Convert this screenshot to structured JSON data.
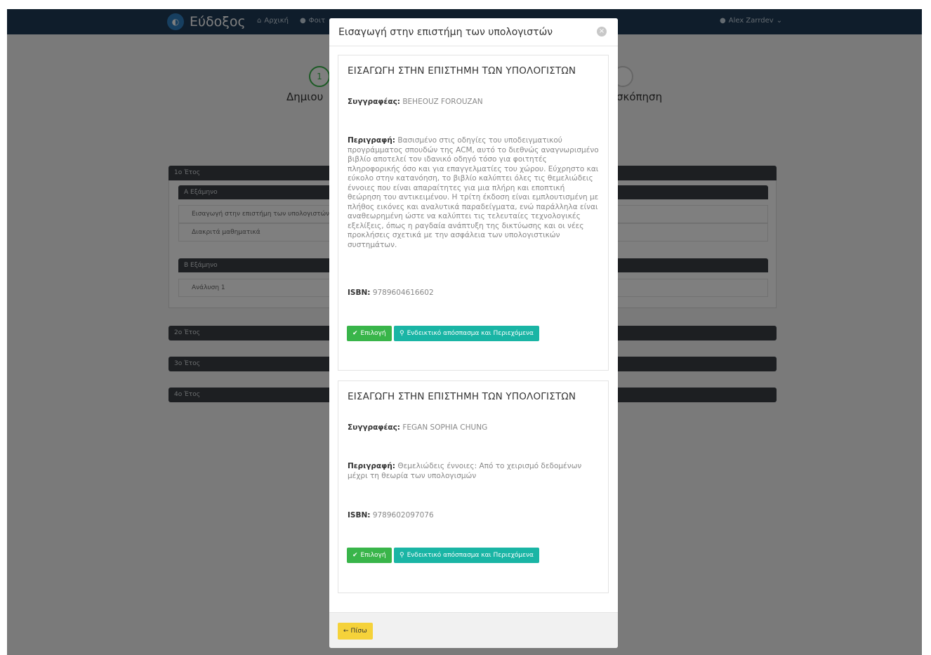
{
  "navbar": {
    "brand": "Εύδοξος",
    "links": [
      {
        "label": "Αρχική",
        "icon": "home-icon"
      },
      {
        "label": "Φοιτ",
        "icon": "user-icon"
      }
    ],
    "user": {
      "name": "Alex Zarrdev",
      "icon": "user-icon"
    }
  },
  "wizard": {
    "step1_number": "1",
    "step1_label": "Δημιου",
    "step_last_label": "σκόπηση"
  },
  "background": {
    "year1": "1ο Έτος",
    "semester_a": "Α Εξάμηνο",
    "semester_a_courses": [
      "Εισαγωγή στην επιστήμη των υπολογιστών",
      "Διακριτά μαθηματικά"
    ],
    "semester_b": "Β Εξάμηνο",
    "semester_b_courses": [
      "Ανάλυση 1"
    ],
    "year2": "2ο Έτος",
    "year3": "3ο Έτος",
    "year4": "4ο Έτος"
  },
  "modal": {
    "title": "Εισαγωγή στην επιστήμη των υπολογιστών",
    "close_label": "×",
    "author_label": "Συγγραφέας:",
    "description_label": "Περιγραφή:",
    "isbn_label": "ISBN:",
    "select_label": "Επιλογή",
    "preview_label": "Ενδεικτικό απόσπασμα και Περιεχόμενα",
    "back_label": "Πίσω",
    "books": [
      {
        "title": "ΕΙΣΑΓΩΓΗ ΣΤΗΝ ΕΠΙΣΤΗΜΗ ΤΩΝ ΥΠΟΛΟΓΙΣΤΩΝ",
        "author": "BEHEOUZ FOROUZAN",
        "description": "Βασισμένο στις οδηγίες του υποδειγματικού προγράμματος σπουδών της ACM, αυτό το διεθνώς αναγνωρισμένο βιβλίο αποτελεί τον ιδανικό οδηγό τόσο για φοιτητές πληροφορικής όσο και για επαγγελματίες του χώρου. Εύχρηστο και εύκολο στην κατανόηση, το βιβλίο καλύπτει όλες τις θεμελιώδεις έννοιες που είναι απαραίτητες για μια πλήρη και εποπτική θεώρηση του αντικειμένου.  Η τρίτη έκδοση είναι εμπλουτισμένη με πλήθος εικόνες και αναλυτικά παραδείγματα, ενώ παράλληλα είναι αναθεωρημένη ώστε να καλύπτει τις τελευταίες τεχνολογικές εξελίξεις, όπως η ραγδαία ανάπτυξη της δικτύωσης και οι νέες προκλήσεις σχετικά με την ασφάλεια των υπολογιστικών συστημάτων.",
        "isbn": "9789604616602"
      },
      {
        "title": "ΕΙΣΑΓΩΓΗ ΣΤΗΝ ΕΠΙΣΤΗΜΗ ΤΩΝ ΥΠΟΛΟΓΙΣΤΩΝ",
        "author": "FEGAN SOPHIA CHUNG",
        "description": "Θεμελιώδεις έννοιες: Από το χειρισμό δεδομένων μέχρι τη θεωρία των υπολογισμών",
        "isbn": "9789602097076"
      }
    ]
  },
  "colors": {
    "navbar": "#1f3b57",
    "select_button": "#39b54a",
    "preview_button": "#1ab5a5",
    "back_button": "#f5d23a"
  }
}
